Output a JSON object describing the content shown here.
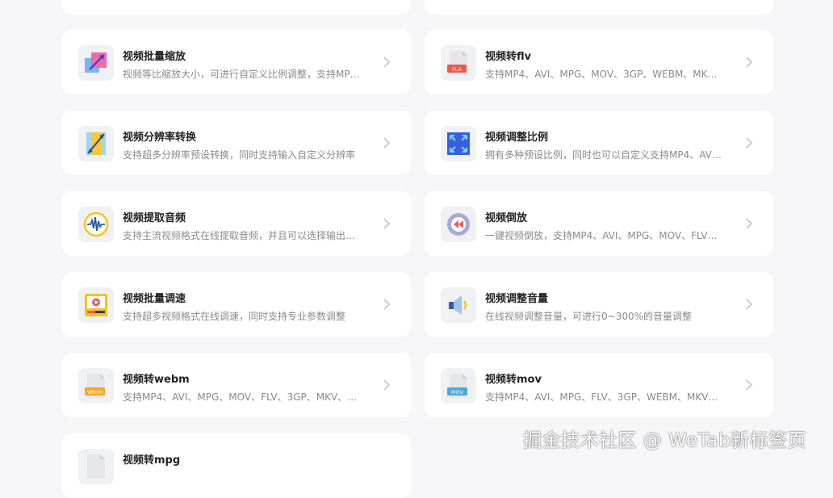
{
  "cards": [
    {
      "title": "视频批量缩放",
      "desc": "视频等比缩放大小，可进行自定义比例调整，支持MP…",
      "icon": "resize-icon"
    },
    {
      "title": "视频转flv",
      "desc": "支持MP4、AVI、MPG、MOV、3GP、WEBM、MK…",
      "icon": "flv-file-icon",
      "badge": "FLA"
    },
    {
      "title": "视频分辨率转换",
      "desc": "支持超多分辨率预设转换，同时支持输入自定义分辨率",
      "icon": "resolution-icon"
    },
    {
      "title": "视频调整比例",
      "desc": "拥有多种预设比例，同时也可以自定义支持MP4、AV…",
      "icon": "aspect-ratio-icon"
    },
    {
      "title": "视频提取音频",
      "desc": "支持主流视频格式在线提取音频，并且可以选择输出…",
      "icon": "waveform-icon"
    },
    {
      "title": "视频倒放",
      "desc": "一键视频倒放，支持MP4、AVI、MPG、MOV、FLV…",
      "icon": "rewind-icon"
    },
    {
      "title": "视频批量调速",
      "desc": "支持超多视频格式在线调速，同时支持专业参数调整",
      "icon": "speed-icon"
    },
    {
      "title": "视频调整音量",
      "desc": "在线视频调整音量，可进行0~300%的音量调整",
      "icon": "volume-icon"
    },
    {
      "title": "视频转webm",
      "desc": "支持MP4、AVI、MPG、MOV、FLV、3GP、MKV、…",
      "icon": "webm-file-icon",
      "badge": "WEBM"
    },
    {
      "title": "视频转mov",
      "desc": "支持MP4、AVI、MPG、FLV、3GP、WEBM、MKV…",
      "icon": "mov-file-icon",
      "badge": "MOV"
    },
    {
      "title": "视频转mpg",
      "desc": "",
      "icon": "mpg-file-icon"
    }
  ],
  "watermark": "掘金技术社区 @ WeTab新标签页",
  "colors": {
    "background": "#f6f6f8",
    "card": "#ffffff",
    "title": "#222222",
    "desc": "#8a8a8a",
    "chevron": "#c4c4c4"
  }
}
